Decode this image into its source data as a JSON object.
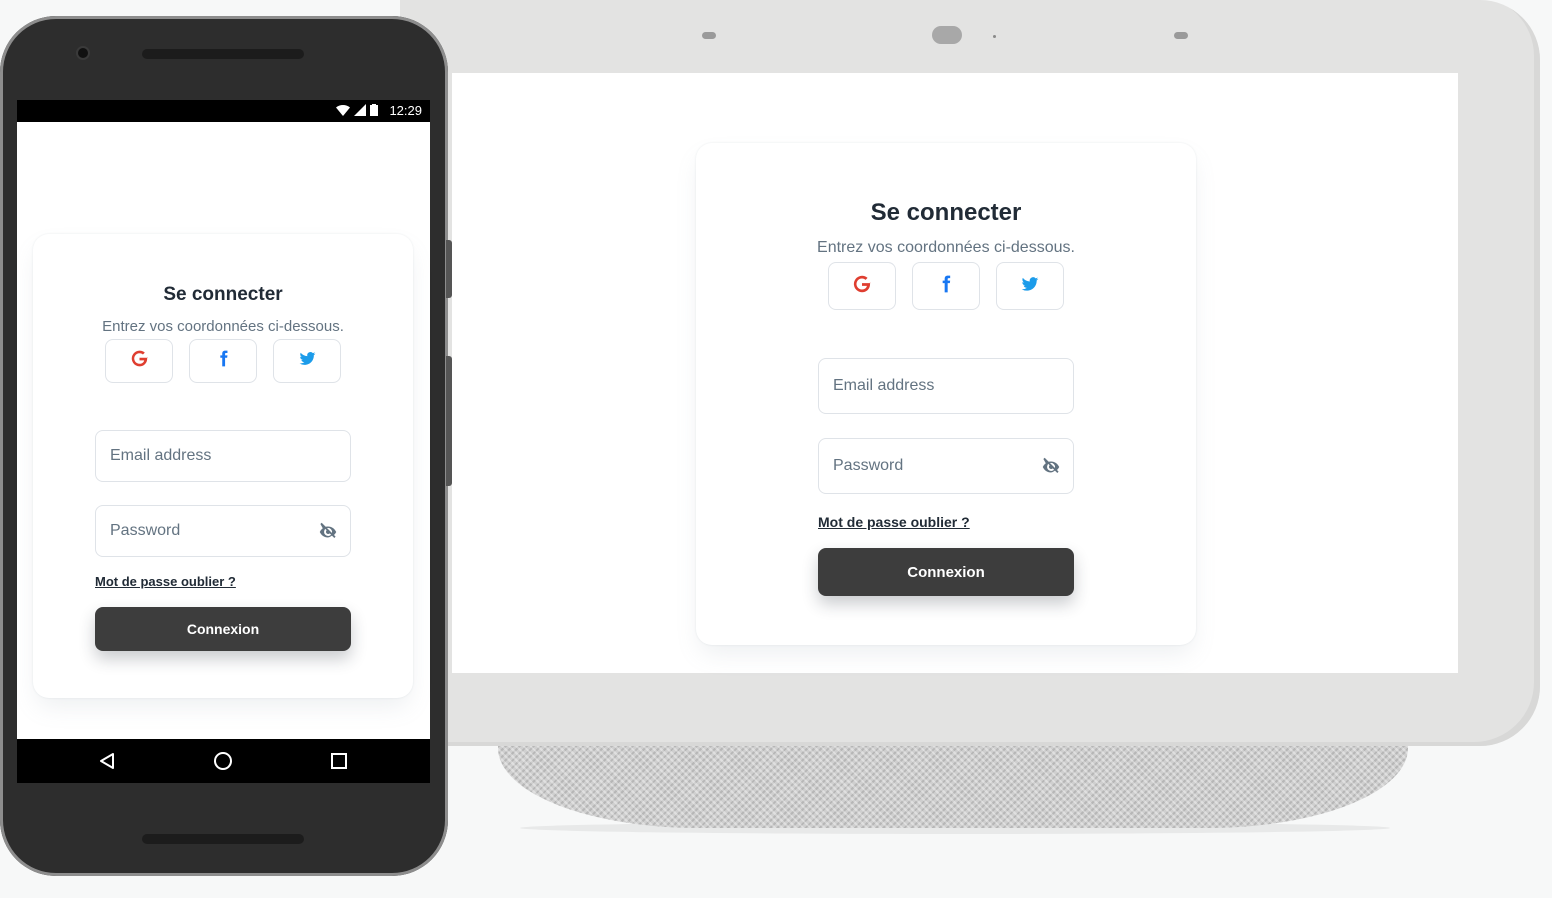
{
  "phone": {
    "status_time": "12:29",
    "nav": {
      "back": "back-icon",
      "home": "home-icon",
      "recents": "recents-icon"
    }
  },
  "login": {
    "title": "Se connecter",
    "subtitle": "Entrez vos coordonnées ci-dessous.",
    "social": [
      {
        "icon": "google-icon",
        "color": "#df3e30"
      },
      {
        "icon": "facebook-icon",
        "color": "#1877f2"
      },
      {
        "icon": "twitter-icon",
        "color": "#1c9cea"
      }
    ],
    "email_placeholder": "Email address",
    "password_placeholder": "Password",
    "forgot_label": "Mot de passe oublier ?",
    "submit_label": "Connexion"
  },
  "colors": {
    "primary_button": "#3d3d3d",
    "text_primary": "#212b36",
    "text_secondary": "#637381",
    "border": "#dfe3e8"
  }
}
